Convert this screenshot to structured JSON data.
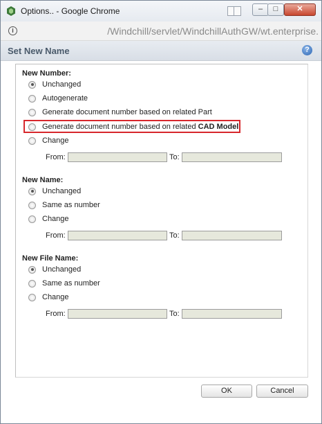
{
  "window": {
    "title": "Options.. - Google Chrome",
    "minimize_glyph": "–",
    "maximize_glyph": "□",
    "close_glyph": "✕"
  },
  "address_bar": {
    "info_glyph": "i",
    "url": "/Windchill/servlet/WindchillAuthGW/wt.enterprise."
  },
  "dialog": {
    "title": "Set New Name",
    "help_glyph": "?"
  },
  "sections": {
    "number": {
      "title": "New Number:",
      "options": [
        {
          "label": "Unchanged",
          "selected": true
        },
        {
          "label": "Autogenerate",
          "selected": false
        },
        {
          "label": "Generate document number based on related Part",
          "selected": false
        },
        {
          "label": "Generate document number based on related",
          "label_bold": "CAD Model",
          "selected": false,
          "highlighted": true
        },
        {
          "label": "Change",
          "selected": false
        }
      ],
      "from_label": "From:",
      "to_label": "To:",
      "from_value": "",
      "to_value": ""
    },
    "name": {
      "title": "New Name:",
      "options": [
        {
          "label": "Unchanged",
          "selected": true
        },
        {
          "label": "Same as number",
          "selected": false
        },
        {
          "label": "Change",
          "selected": false
        }
      ],
      "from_label": "From:",
      "to_label": "To:",
      "from_value": "",
      "to_value": ""
    },
    "file_name": {
      "title": "New File Name:",
      "options": [
        {
          "label": "Unchanged",
          "selected": true
        },
        {
          "label": "Same as number",
          "selected": false
        },
        {
          "label": "Change",
          "selected": false
        }
      ],
      "from_label": "From:",
      "to_label": "To:",
      "from_value": "",
      "to_value": ""
    }
  },
  "buttons": {
    "ok": "OK",
    "cancel": "Cancel"
  },
  "colors": {
    "highlight_border": "#d7272c",
    "header_title": "#4a5a6b",
    "field_bg": "#e6e8dc"
  }
}
